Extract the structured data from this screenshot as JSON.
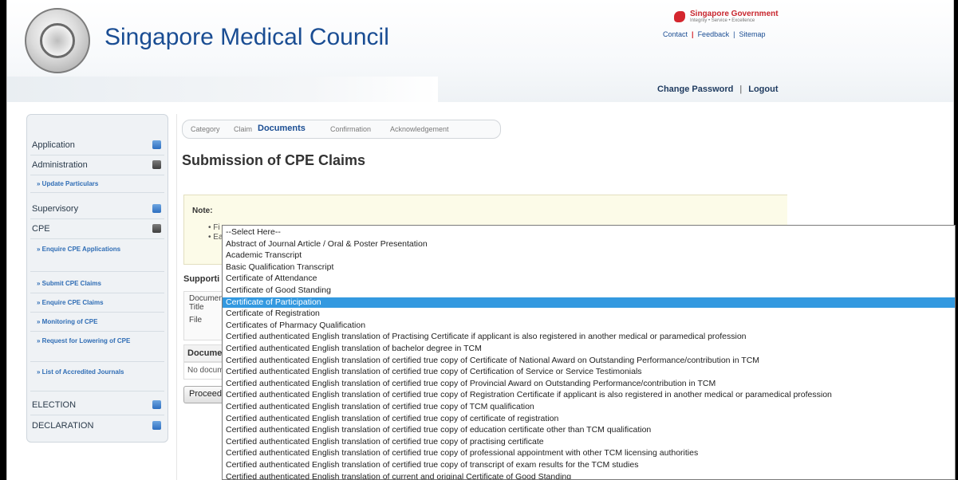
{
  "header": {
    "site_title": "Singapore Medical Council",
    "gov_logo_main": "Singapore Government",
    "gov_logo_sub": "Integrity • Service • Excellence",
    "links": [
      "Contact",
      "Feedback",
      "Sitemap"
    ],
    "user_links": [
      "Change Password",
      "Logout"
    ]
  },
  "sidebar": {
    "sections": [
      {
        "label": "Application",
        "icon": "expand-icon"
      },
      {
        "label": "Administration",
        "icon": "collapse-icon"
      },
      {
        "label": "Supervisory",
        "icon": "expand-icon"
      },
      {
        "label": "CPE",
        "icon": "collapse-icon"
      },
      {
        "label": "ELECTION",
        "icon": "expand-icon"
      },
      {
        "label": "DECLARATION",
        "icon": "expand-icon"
      }
    ],
    "admin_items": [
      "» Update Particulars"
    ],
    "cpe_items": [
      "» Enquire CPE Applications",
      "» Submit CPE Claims",
      "» Enquire CPE Claims",
      "» Monitoring of CPE",
      "» Request for Lowering of CPE",
      "» List of Accredited Journals"
    ]
  },
  "main": {
    "tabs": [
      "Category",
      "Claim",
      "Documents",
      "Confirmation",
      "Acknowledgement"
    ],
    "active_tab": "Documents",
    "page_title": "Submission of CPE Claims",
    "note_title": "Note:",
    "note_bullets": [
      "• Fi",
      "• Ea"
    ],
    "supporting_label": "Supporti",
    "form_labels": [
      "Documen",
      "Title",
      "File"
    ],
    "documents_header": "Documen",
    "documents_empty": "No docum",
    "proceed_label": "Proceed"
  },
  "dropdown": {
    "selected_index": 6,
    "options": [
      "--Select Here--",
      "Abstract of Journal Article / Oral & Poster Presentation",
      "Academic Transcript",
      "Basic Qualification Transcript",
      "Certificate of Attendance",
      "Certificate of Good Standing",
      "Certificate of Participation",
      "Certificate of Registration",
      "Certificates of Pharmacy Qualification",
      "Certified authenticated English translation of Practising Certificate if applicant is also registered in another medical or paramedical profession",
      "Certified authenticated English translation of bachelor degree in TCM",
      "Certified authenticated English translation of certified true copy of Certificate of National Award on Outstanding Performance/contribution in TCM",
      "Certified authenticated English translation of certified true copy of Certification of Service or Service Testimonials",
      "Certified authenticated English translation of certified true copy of Provincial Award on Outstanding Performance/contribution in TCM",
      "Certified authenticated English translation of certified true copy of Registration Certificate if applicant is also registered in another medical or paramedical profession",
      "Certified authenticated English translation of certified true copy of TCM qualification",
      "Certified authenticated English translation of certified true copy of certificate of registration",
      "Certified authenticated English translation of certified true copy of education certificate other than TCM qualification",
      "Certified authenticated English translation of certified true copy of practising certificate",
      "Certified authenticated English translation of certified true copy of professional appointment with other TCM licensing authorities",
      "Certified authenticated English translation of certified true copy of transcript of exam results for the TCM studies",
      "Certified authenticated English translation of current and original Certificate of Good Standing"
    ]
  },
  "colors": {
    "brand_blue": "#1a4d93",
    "gov_red": "#c8262e",
    "selection": "#3399e0"
  }
}
